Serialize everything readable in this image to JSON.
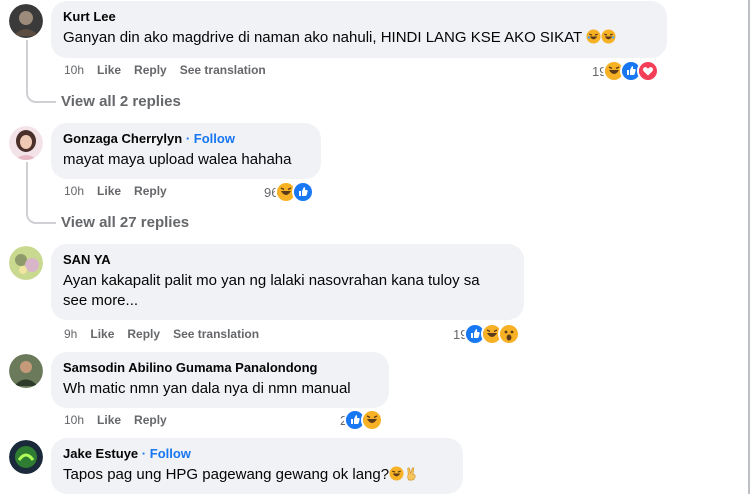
{
  "comments": [
    {
      "author": "Kurt Lee",
      "follow": "",
      "text": "Ganyan din ako magdrive di naman ako nahuli, HINDI LANG KSE AKO SIKAT",
      "time": "10h",
      "like": "Like",
      "reply": "Reply",
      "translation": "See translation",
      "reaction_count": "19",
      "reactions": [
        "haha-icon",
        "like-icon",
        "love-icon"
      ]
    },
    {
      "author": "Gonzaga Cherrylyn",
      "follow": "Follow",
      "text": "mayat maya upload walea hahaha",
      "time": "10h",
      "like": "Like",
      "reply": "Reply",
      "translation": "",
      "reaction_count": "96",
      "reactions": [
        "haha-icon",
        "like-icon"
      ]
    },
    {
      "author": "SAN YA",
      "follow": "",
      "text": "Ayan kakapalit palit mo yan ng lalaki nasovrahan kana tuloy sa",
      "see_more": "see more...",
      "time": "9h",
      "like": "Like",
      "reply": "Reply",
      "translation": "See translation",
      "reaction_count": "19",
      "reactions": [
        "like-icon",
        "haha-icon",
        "wow-icon"
      ]
    },
    {
      "author": "Samsodin Abilino Gumama Panalondong",
      "follow": "",
      "text": "Wh matic nmn yan dala nya di nmn manual",
      "time": "10h",
      "like": "Like",
      "reply": "Reply",
      "translation": "",
      "reaction_count": "2",
      "reactions": [
        "like-icon",
        "haha-icon"
      ]
    },
    {
      "author": "Jake Estuye",
      "follow": "Follow",
      "text": "Tapos pag ung HPG pagewang gewang ok lang?",
      "time": "",
      "like": "",
      "reply": "",
      "translation": "",
      "reaction_count": "",
      "reactions": []
    }
  ],
  "view_replies": [
    "View all 2 replies",
    "View all 27 replies"
  ],
  "separator": "·",
  "colors": {
    "bubble": "#f0f2f5",
    "secondary_text": "#65676b",
    "link_blue": "#1877f2",
    "like_blue": "#1877f2",
    "love_red": "#f33e58",
    "haha_yellow": "#f7b125"
  }
}
